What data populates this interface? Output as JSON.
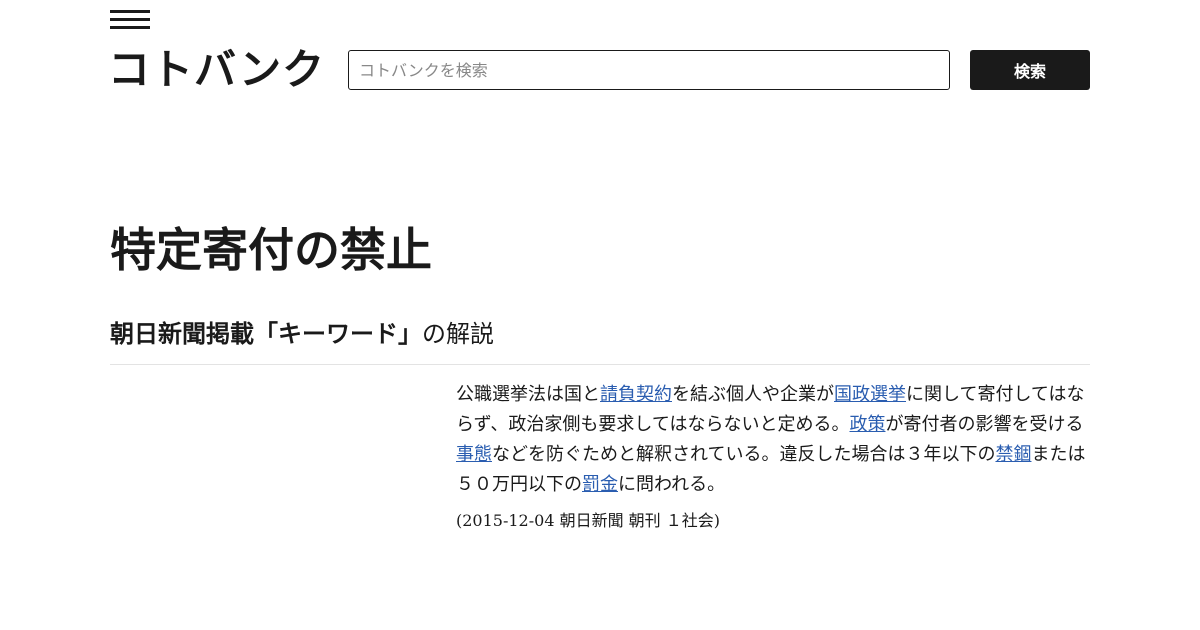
{
  "header": {
    "logo_text": "コトバンク",
    "search_placeholder": "コトバンクを検索",
    "search_value": "",
    "search_button_label": "検索"
  },
  "article": {
    "title": "特定寄付の禁止",
    "section_source": "朝日新聞掲載「キーワード」",
    "section_suffix": "の解説",
    "paragraph": [
      {
        "t": "公職選挙法は国と"
      },
      {
        "t": "請負契約",
        "link": true
      },
      {
        "t": "を結ぶ個人や企業が"
      },
      {
        "t": "国政選挙",
        "link": true
      },
      {
        "t": "に関して寄付してはならず、政治家側も要求してはならないと定める。"
      },
      {
        "t": "政策",
        "link": true
      },
      {
        "t": "が寄付者の影響を受ける"
      },
      {
        "t": "事態",
        "link": true
      },
      {
        "t": "などを防ぐためと解釈されている。違反した場合は３年以下の"
      },
      {
        "t": "禁錮",
        "link": true
      },
      {
        "t": "または５０万円以下の"
      },
      {
        "t": "罰金",
        "link": true
      },
      {
        "t": "に問われる。"
      }
    ],
    "source_line": "(2015-12-04 朝日新聞 朝刊 １社会)"
  },
  "colors": {
    "text": "#1a1a1a",
    "link": "#2a5db0",
    "button_bg": "#1a1a1a",
    "button_text": "#ffffff",
    "divider": "#e3e3e3"
  },
  "icons": {
    "menu": "hamburger-menu-icon"
  }
}
